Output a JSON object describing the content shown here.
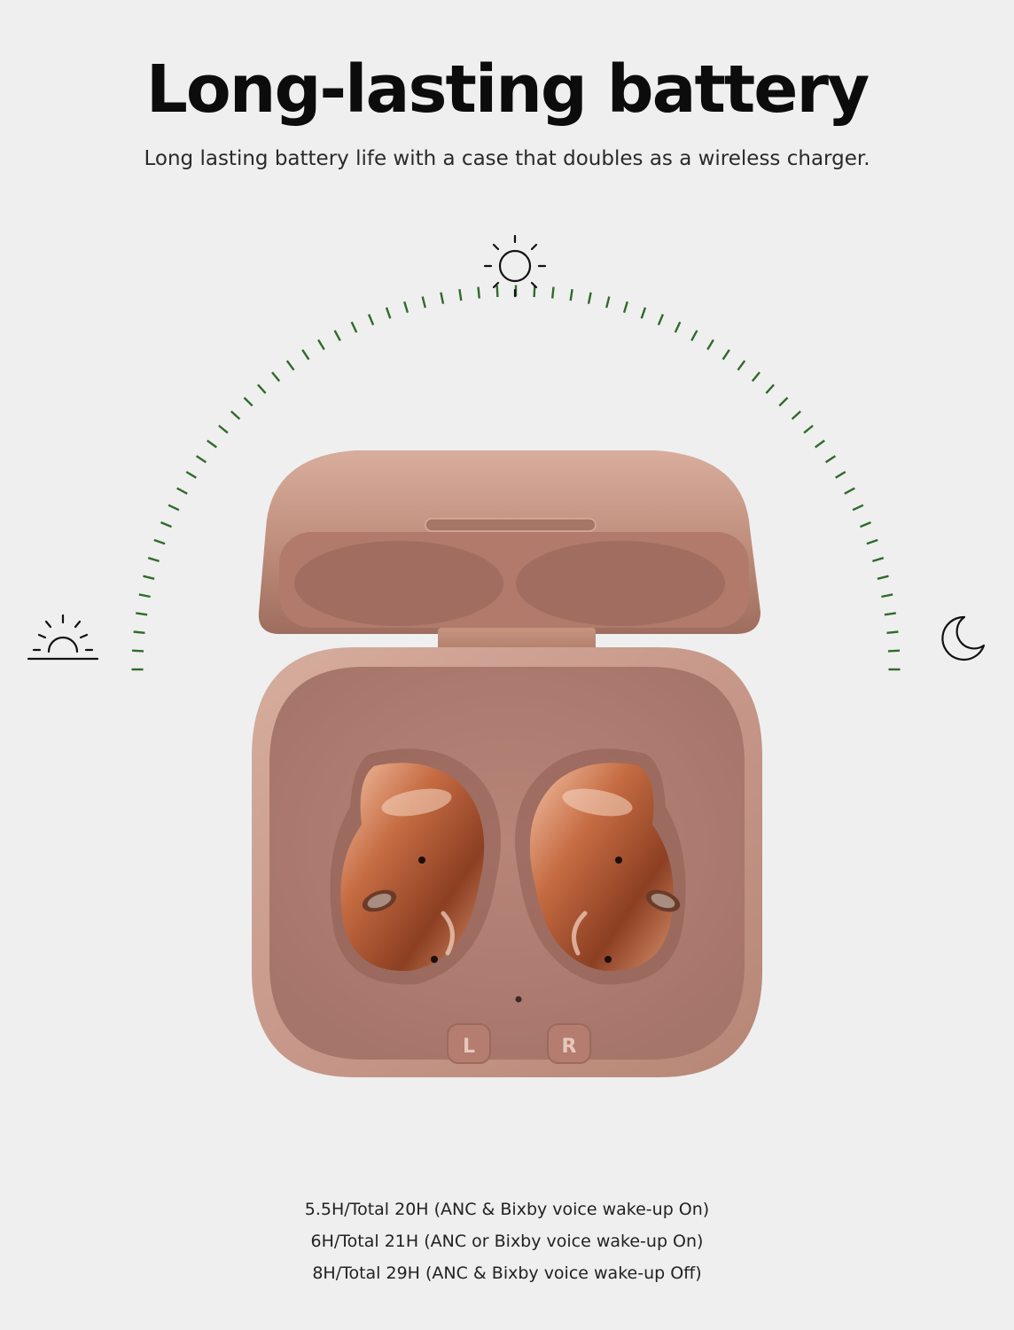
{
  "header": {
    "title": "Long-lasting battery",
    "subtitle": "Long lasting battery life with a case that doubles as a wireless charger."
  },
  "icons": {
    "sun": "sun-icon",
    "sunrise": "sunrise-icon",
    "moon": "moon-icon"
  },
  "product": {
    "left_label": "L",
    "right_label": "R"
  },
  "battery_specs": [
    "5.5H/Total 20H (ANC & Bixby voice wake-up On)",
    "6H/Total 21H (ANC or Bixby voice wake-up On)",
    "8H/Total 29H (ANC & Bixby voice wake-up Off)"
  ],
  "colors": {
    "background": "#efefef",
    "arc_ticks": "#2f6b2a",
    "case_bronze": "#b98573",
    "bud_bronze": "#b5633f"
  }
}
